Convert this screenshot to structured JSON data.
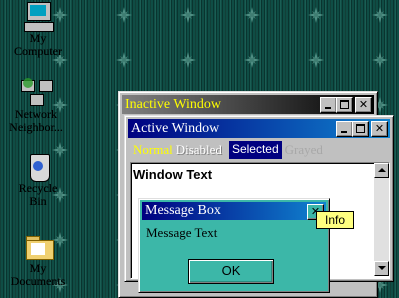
{
  "desktop": {
    "icons": [
      {
        "id": "my-computer",
        "label_line1": "My",
        "label_line2": "Computer"
      },
      {
        "id": "network-neighborhood",
        "label_line1": "Network",
        "label_line2": "Neighbor..."
      },
      {
        "id": "recycle-bin",
        "label_line1": "Recycle",
        "label_line2": "Bin"
      },
      {
        "id": "my-documents",
        "label_line1": "My",
        "label_line2": "Documents"
      }
    ],
    "pattern_icon": "star-tile-icon"
  },
  "inactive_window": {
    "title": "Inactive Window",
    "title_gradient": [
      "#808080",
      "#000000"
    ],
    "title_text_color": "#ffff00"
  },
  "active_window": {
    "title": "Active Window",
    "title_gradient": [
      "#000080",
      "#1084d0"
    ],
    "menu": {
      "normal": "Normal",
      "disabled": "Disabled",
      "selected": "Selected",
      "grayed": "Grayed"
    },
    "window_text": "Window Text"
  },
  "message_box": {
    "title": "Message Box",
    "text": "Message Text",
    "ok_label": "OK",
    "background": "#3cb7a8"
  },
  "tooltip": {
    "text": "Info"
  },
  "window_buttons": {
    "minimize": "minimize-icon",
    "maximize": "maximize-icon",
    "close": "close-icon",
    "close_glyph": "✕"
  }
}
